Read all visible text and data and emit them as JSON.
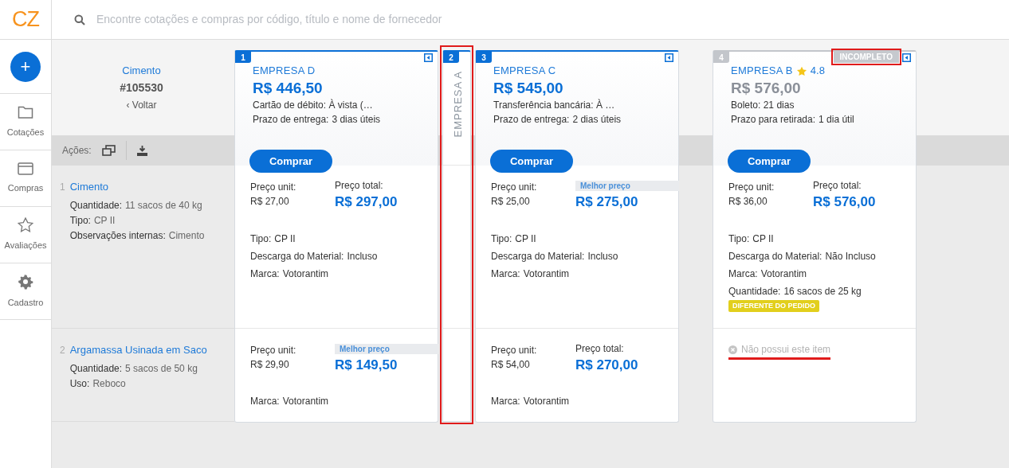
{
  "logo": "CZ",
  "search": {
    "placeholder": "Encontre cotações e compras por código, título e nome de fornecedor"
  },
  "sidebar": {
    "new_button": "+",
    "items": [
      {
        "kind": "folder",
        "label": "Cotações"
      },
      {
        "kind": "card",
        "label": "Compras"
      },
      {
        "kind": "star",
        "label": "Avaliações"
      },
      {
        "kind": "gear",
        "label": "Cadastro"
      }
    ]
  },
  "quote": {
    "title": "Cimento",
    "code": "#105530",
    "back_link": "‹ Voltar"
  },
  "actions": {
    "label": "Ações:"
  },
  "items": [
    {
      "index": "1",
      "name": "Cimento",
      "details": [
        {
          "label": "Quantidade:",
          "value": "11 sacos de 40 kg"
        },
        {
          "label": "Tipo:",
          "value": "CP II"
        },
        {
          "label": "Observações internas:",
          "value": "Cimento"
        }
      ]
    },
    {
      "index": "2",
      "name": "Argamassa Usinada em Saco",
      "details": [
        {
          "label": "Quantidade:",
          "value": "5 sacos de 50 kg"
        },
        {
          "label": "Uso:",
          "value": "Reboco"
        }
      ]
    }
  ],
  "suppliers": [
    {
      "rank": "1",
      "name": "EMPRESA D",
      "collapsed": false,
      "incomplete": false,
      "total": "R$ 446,50",
      "payment": "Cartão de débito: À vista (…",
      "delivery": {
        "label": "Prazo de entrega:",
        "value": "3 dias úteis"
      },
      "buy_button": "Comprar",
      "offers": [
        {
          "kind": "offer",
          "unit_label": "Preço unit:",
          "unit_price": "R$ 27,00",
          "total_label": "Preço total:",
          "best_price": false,
          "total": "R$ 297,00",
          "specs": [
            {
              "label": "Tipo:",
              "value": "CP II"
            },
            {
              "label": "Descarga do Material:",
              "value": "Incluso"
            },
            {
              "label": "Marca:",
              "value": "Votorantim"
            }
          ]
        },
        {
          "kind": "offer",
          "unit_label": "Preço unit:",
          "unit_price": "R$ 29,90",
          "total_label": "Melhor preço",
          "best_price": true,
          "total": "R$ 149,50",
          "specs": [
            {
              "label": "Marca:",
              "value": "Votorantim"
            }
          ]
        }
      ]
    },
    {
      "rank": "2",
      "name": "EMPRESA A",
      "collapsed": true,
      "incomplete": false,
      "annotated": true
    },
    {
      "rank": "3",
      "name": "EMPRESA C",
      "collapsed": false,
      "incomplete": false,
      "total": "R$ 545,00",
      "payment": "Transferência bancária: À …",
      "delivery": {
        "label": "Prazo de entrega:",
        "value": "2 dias úteis"
      },
      "buy_button": "Comprar",
      "offers": [
        {
          "kind": "offer",
          "unit_label": "Preço unit:",
          "unit_price": "R$ 25,00",
          "total_label": "Melhor preço",
          "best_price": true,
          "total": "R$ 275,00",
          "specs": [
            {
              "label": "Tipo:",
              "value": "CP II"
            },
            {
              "label": "Descarga do Material:",
              "value": "Incluso"
            },
            {
              "label": "Marca:",
              "value": "Votorantim"
            }
          ]
        },
        {
          "kind": "offer",
          "unit_label": "Preço unit:",
          "unit_price": "R$ 54,00",
          "total_label": "Preço total:",
          "best_price": false,
          "total": "R$ 270,00",
          "specs": [
            {
              "label": "Marca:",
              "value": "Votorantim"
            }
          ]
        }
      ]
    },
    {
      "rank": "4",
      "name": "EMPRESA B",
      "rating": "4.8",
      "status": "INCOMPLETO",
      "status_annotated": true,
      "collapsed": false,
      "incomplete": true,
      "total": "R$ 576,00",
      "payment": "Boleto: 21 dias",
      "delivery": {
        "label": "Prazo para retirada:",
        "value": "1 dia útil"
      },
      "buy_button": "Comprar",
      "offers": [
        {
          "kind": "offer",
          "unit_label": "Preço unit:",
          "unit_price": "R$ 36,00",
          "total_label": "Preço total:",
          "best_price": false,
          "total": "R$ 576,00",
          "specs": [
            {
              "label": "Tipo:",
              "value": "CP II"
            },
            {
              "label": "Descarga do Material:",
              "value": "Não Incluso"
            },
            {
              "label": "Marca:",
              "value": "Votorantim"
            },
            {
              "label": "Quantidade:",
              "value": "16 sacos de 25 kg",
              "flag": "DIFERENTE DO PEDIDO"
            }
          ]
        },
        {
          "kind": "missing",
          "text": "Não possui este item",
          "annotated": true
        }
      ]
    }
  ]
}
